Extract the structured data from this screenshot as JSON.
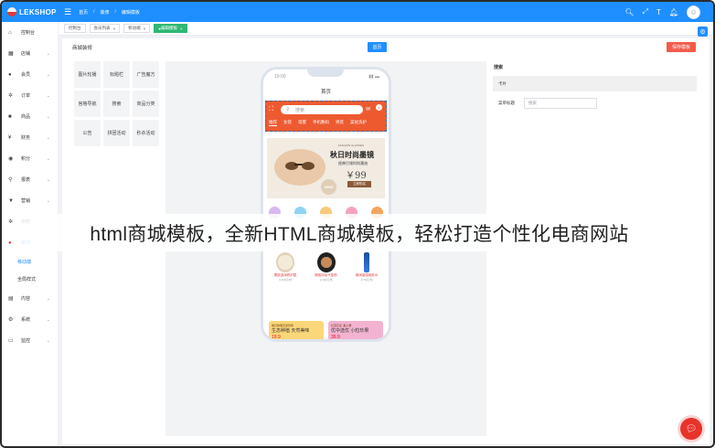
{
  "topbar": {
    "logo": "LEKSHOP",
    "breadcrumbs": [
      "首页",
      "装修",
      "编辑模板"
    ]
  },
  "sidebar": {
    "items": [
      {
        "label": "控制台",
        "icon": "home-icon"
      },
      {
        "label": "店铺",
        "icon": "shop-icon"
      },
      {
        "label": "会员",
        "icon": "user-icon"
      },
      {
        "label": "订单",
        "icon": "gear-icon"
      },
      {
        "label": "商品",
        "icon": "box-icon"
      },
      {
        "label": "财务",
        "icon": "yen-icon"
      },
      {
        "label": "积分",
        "icon": "circle-icon"
      },
      {
        "label": "报表",
        "icon": "search-icon"
      },
      {
        "label": "营销",
        "icon": "shirt-icon"
      },
      {
        "label": "参数",
        "icon": "gear-icon"
      },
      {
        "label": "装修",
        "icon": "brush-icon"
      }
    ],
    "sub_items": [
      "移动端",
      "全局样式"
    ],
    "tail_items": [
      {
        "label": "内容",
        "icon": "layers-icon"
      },
      {
        "label": "系统",
        "icon": "settings-icon"
      },
      {
        "label": "监控",
        "icon": "monitor-icon"
      }
    ]
  },
  "tabs": [
    "控制台",
    "会员列表",
    "移动端",
    "编辑模板"
  ],
  "main": {
    "title": "商城装修",
    "home_button": "首页",
    "save_button": "保存模板",
    "palette": [
      "图片轮播",
      "标题栏",
      "广告魔方",
      "宫格导航",
      "搜索",
      "商品分类",
      "公告",
      "拼团活动",
      "秒杀活动"
    ]
  },
  "phone": {
    "time": "10:00",
    "title": "首页",
    "search_placeholder": "搜索",
    "badge": "4",
    "nav": [
      "推荐",
      "女装",
      "母婴",
      "手机数码",
      "男装",
      "美妆洗护"
    ],
    "banner": {
      "dots": "FASHION GLASSES",
      "title": "秋日时尚墨镜",
      "subtitle": "经典引领时尚潮流",
      "price": "￥99",
      "buy": "立即购买",
      "badge": "NEW"
    },
    "goods": [
      {
        "name": "雪肤滋润修护霜",
        "price": "￥130元/件"
      },
      {
        "name": "精致持妆气垫粉",
        "price": "￥130元/件"
      },
      {
        "name": "弹润保湿爽肤水",
        "price": "￥79元/件"
      }
    ],
    "cards": [
      {
        "tag": "每日鲜果直送到家",
        "title": "生态种植 天然美味",
        "price": "19.9"
      },
      {
        "tag": "红宝石系 '美人果'",
        "title": "优中选优 小粒珍果",
        "price": "39.9"
      }
    ]
  },
  "right_panel": {
    "title": "搜索",
    "tab": "卡片",
    "field_label": "菜单标题",
    "field_value": "搜索"
  },
  "overlay_text": "html商城模板，全新HTML商城模板，轻松打造个性化电商网站",
  "colors": {
    "primary": "#1f8fff",
    "danger": "#f25a4a",
    "success": "#2eb873",
    "phone_header": "#ee5a30"
  }
}
